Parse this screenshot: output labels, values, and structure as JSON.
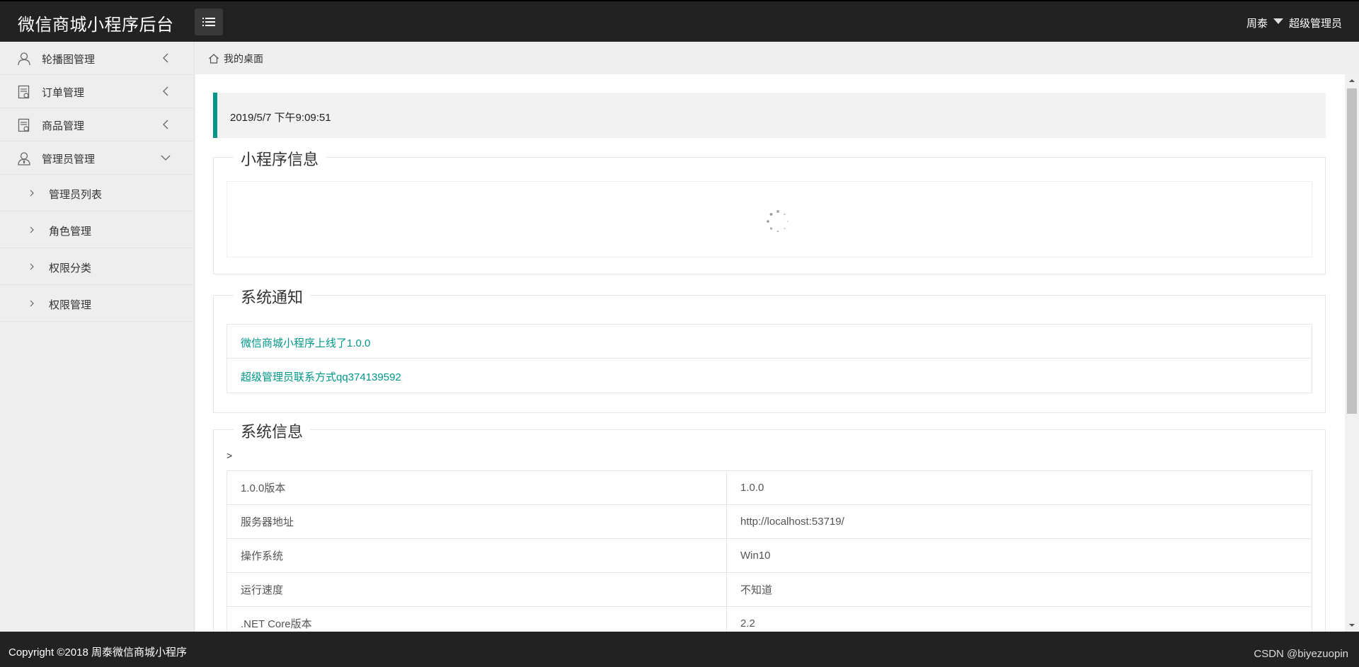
{
  "app": {
    "title": "微信商城小程序后台",
    "user_name": "周泰",
    "user_role": "超级管理员"
  },
  "sidebar": {
    "items": [
      {
        "label": "轮播图管理",
        "icon": "user-icon",
        "state": "collapsed"
      },
      {
        "label": "订单管理",
        "icon": "document-icon",
        "state": "collapsed"
      },
      {
        "label": "商品管理",
        "icon": "document-icon",
        "state": "collapsed"
      },
      {
        "label": "管理员管理",
        "icon": "user-icon",
        "state": "expanded"
      }
    ],
    "subitems": [
      {
        "label": "管理员列表"
      },
      {
        "label": "角色管理"
      },
      {
        "label": "权限分类"
      },
      {
        "label": "权限管理"
      }
    ]
  },
  "breadcrumb": {
    "icon": "home-icon",
    "label": "我的桌面"
  },
  "main": {
    "datetime": "2019/5/7 下午9:09:51",
    "miniprogram_section": {
      "title": "小程序信息"
    },
    "notice_section": {
      "title": "系统通知",
      "items": [
        "微信商城小程序上线了1.0.0",
        "超级管理员联系方式qq374139592"
      ]
    },
    "sysinfo_section": {
      "title": "系统信息",
      "stray_text": ">",
      "rows": [
        {
          "key": "1.0.0版本",
          "value": "1.0.0"
        },
        {
          "key": "服务器地址",
          "value": "http://localhost:53719/"
        },
        {
          "key": "操作系统",
          "value": "Win10"
        },
        {
          "key": "运行速度",
          "value": "不知道"
        },
        {
          "key": ".NET Core版本",
          "value": "2.2"
        }
      ]
    }
  },
  "footer": {
    "copyright": "Copyright ©2018 周泰微信商城小程序",
    "watermark": "CSDN @biyezuopin"
  },
  "colors": {
    "header_bg": "#222222",
    "accent": "#009688",
    "sidebar_bg": "#eeeeee"
  }
}
